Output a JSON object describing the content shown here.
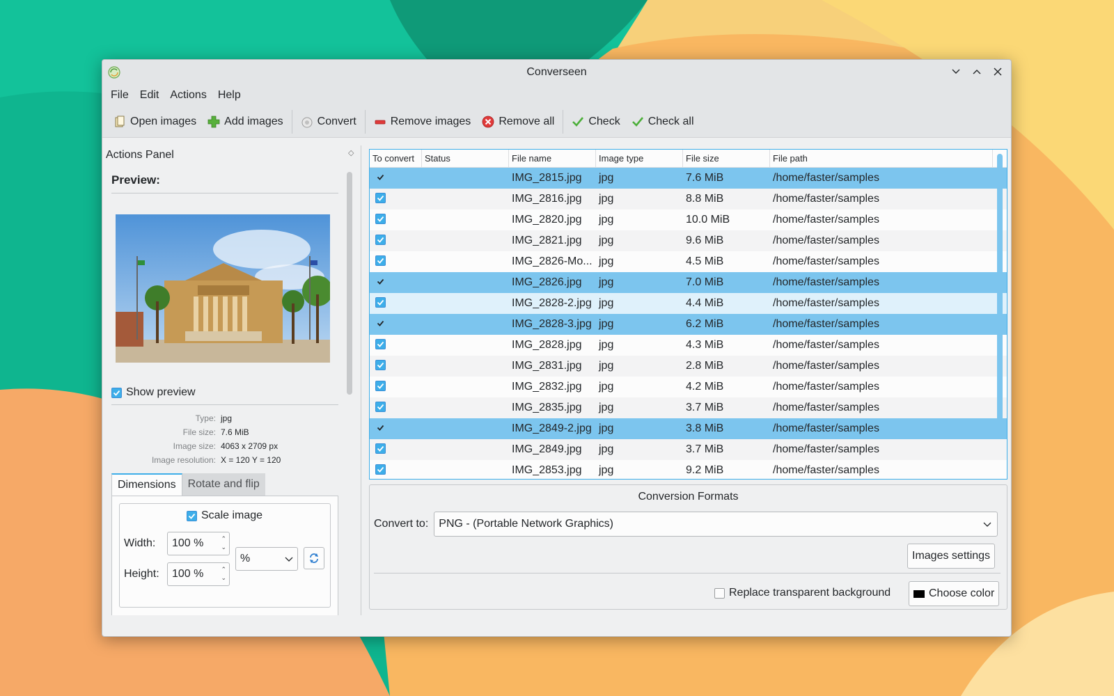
{
  "window": {
    "title": "Converseen"
  },
  "menu": [
    "File",
    "Edit",
    "Actions",
    "Help"
  ],
  "toolbar": {
    "open_images": "Open images",
    "add_images": "Add images",
    "convert": "Convert",
    "remove_images": "Remove images",
    "remove_all": "Remove all",
    "check": "Check",
    "check_all": "Check all"
  },
  "actions_panel": {
    "title": "Actions Panel",
    "preview_heading": "Preview:",
    "show_preview_label": "Show preview",
    "info": [
      {
        "label": "Type:",
        "value": "jpg"
      },
      {
        "label": "File size:",
        "value": "7.6 MiB"
      },
      {
        "label": "Image size:",
        "value": "4063 x 2709 px"
      },
      {
        "label": "Image resolution:",
        "value": "X = 120 Y = 120"
      }
    ],
    "tabs": [
      "Dimensions",
      "Rotate and flip"
    ],
    "scale_image_label": "Scale image",
    "width_label": "Width:",
    "height_label": "Height:",
    "width_value": "100 %",
    "height_value": "100 %",
    "unit_value": "%"
  },
  "table": {
    "columns": [
      "To convert",
      "Status",
      "File name",
      "Image type",
      "File size",
      "File path"
    ],
    "rows": [
      {
        "name": "IMG_2815.jpg",
        "type": "jpg",
        "size": "7.6 MiB",
        "path": "/home/faster/samples",
        "state": "sel"
      },
      {
        "name": "IMG_2816.jpg",
        "type": "jpg",
        "size": "8.8 MiB",
        "path": "/home/faster/samples",
        "state": "alt"
      },
      {
        "name": "IMG_2820.jpg",
        "type": "jpg",
        "size": "10.0 MiB",
        "path": "/home/faster/samples",
        "state": ""
      },
      {
        "name": "IMG_2821.jpg",
        "type": "jpg",
        "size": "9.6 MiB",
        "path": "/home/faster/samples",
        "state": "alt"
      },
      {
        "name": "IMG_2826-Mo...",
        "type": "jpg",
        "size": "4.5 MiB",
        "path": "/home/faster/samples",
        "state": ""
      },
      {
        "name": "IMG_2826.jpg",
        "type": "jpg",
        "size": "7.0 MiB",
        "path": "/home/faster/samples",
        "state": "sel"
      },
      {
        "name": "IMG_2828-2.jpg",
        "type": "jpg",
        "size": "4.4 MiB",
        "path": "/home/faster/samples",
        "state": "hover"
      },
      {
        "name": "IMG_2828-3.jpg",
        "type": "jpg",
        "size": "6.2 MiB",
        "path": "/home/faster/samples",
        "state": "sel"
      },
      {
        "name": "IMG_2828.jpg",
        "type": "jpg",
        "size": "4.3 MiB",
        "path": "/home/faster/samples",
        "state": ""
      },
      {
        "name": "IMG_2831.jpg",
        "type": "jpg",
        "size": "2.8 MiB",
        "path": "/home/faster/samples",
        "state": "alt"
      },
      {
        "name": "IMG_2832.jpg",
        "type": "jpg",
        "size": "4.2 MiB",
        "path": "/home/faster/samples",
        "state": ""
      },
      {
        "name": "IMG_2835.jpg",
        "type": "jpg",
        "size": "3.7 MiB",
        "path": "/home/faster/samples",
        "state": "alt"
      },
      {
        "name": "IMG_2849-2.jpg",
        "type": "jpg",
        "size": "3.8 MiB",
        "path": "/home/faster/samples",
        "state": "sel"
      },
      {
        "name": "IMG_2849.jpg",
        "type": "jpg",
        "size": "3.7 MiB",
        "path": "/home/faster/samples",
        "state": "alt"
      },
      {
        "name": "IMG_2853.jpg",
        "type": "jpg",
        "size": "9.2 MiB",
        "path": "/home/faster/samples",
        "state": ""
      }
    ]
  },
  "conversion": {
    "title": "Conversion Formats",
    "convert_to_label": "Convert to:",
    "format_value": "PNG - (Portable Network Graphics)",
    "images_settings": "Images settings",
    "replace_bg_label": "Replace transparent background",
    "choose_color": "Choose color"
  },
  "colors": {
    "accent": "#3daee9",
    "selection": "#7cc5ee",
    "window_bg": "#eff0f1"
  }
}
